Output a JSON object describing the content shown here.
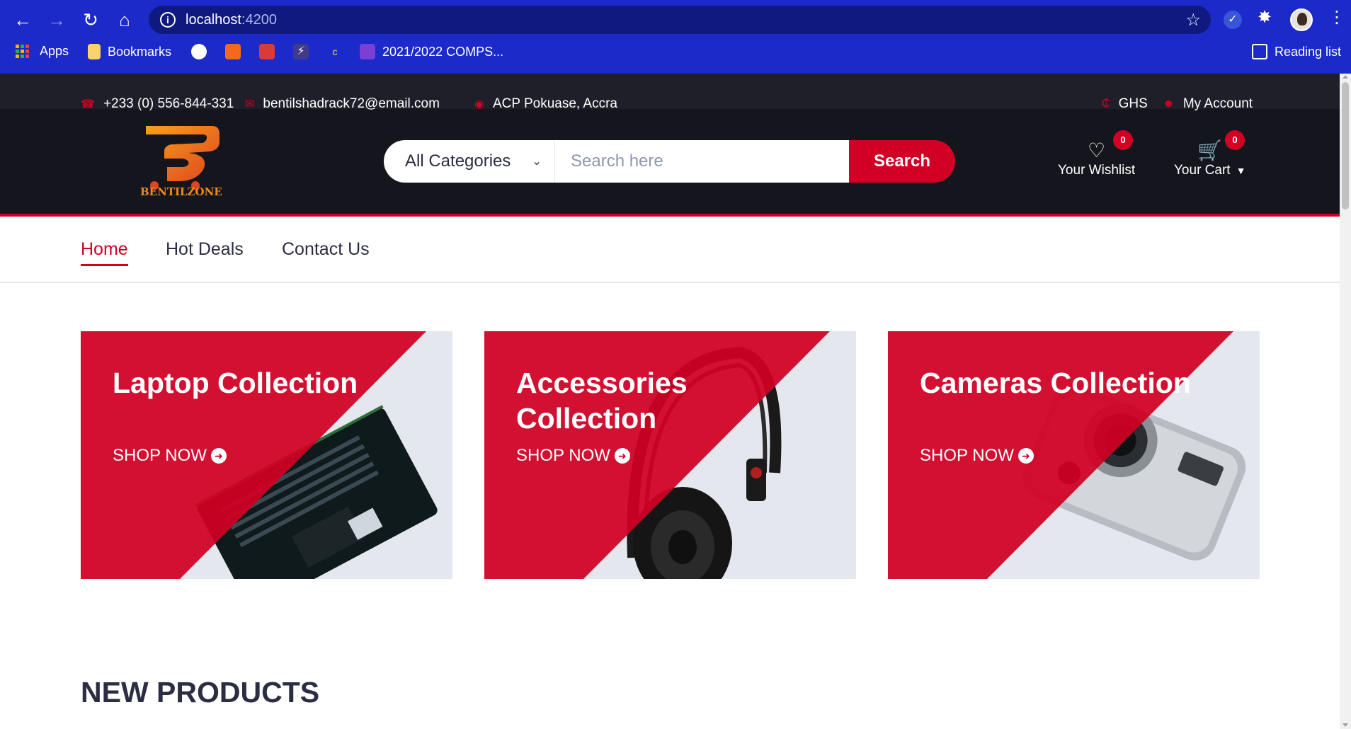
{
  "browser": {
    "url_host": "localhost",
    "url_port": ":4200",
    "bookmarks": [
      {
        "label": "Apps",
        "icon": "apps-grid-icon"
      },
      {
        "label": "Bookmarks",
        "icon": "folder-icon"
      },
      {
        "label": "",
        "icon": "github-icon"
      },
      {
        "label": "",
        "icon": "grid-bookmark-icon"
      },
      {
        "label": "",
        "icon": "spiral-bookmark-icon"
      },
      {
        "label": "",
        "icon": "bolt-bookmark-icon"
      },
      {
        "label": "",
        "icon": "c-bookmark-icon"
      },
      {
        "label": "2021/2022 COMPS...",
        "icon": "list-bookmark-icon"
      }
    ],
    "reading_list": "Reading list"
  },
  "header": {
    "phone": "+233 (0) 556-844-331",
    "email": "bentilshadrack72@email.com",
    "location": "ACP Pokuase, Accra",
    "currency": "GHS",
    "account": "My Account"
  },
  "brand": {
    "name": "BENTILZONE",
    "colors": {
      "accent": "#d10024",
      "dark": "#15161d",
      "logo_orange": "#f28b1a"
    }
  },
  "search": {
    "category": "All Categories",
    "placeholder": "Search here",
    "button": "Search"
  },
  "actions": {
    "wishlist_label": "Your Wishlist",
    "wishlist_count": "0",
    "cart_label": "Your Cart",
    "cart_count": "0"
  },
  "nav": {
    "items": [
      {
        "label": "Home",
        "active": true
      },
      {
        "label": "Hot Deals",
        "active": false
      },
      {
        "label": "Contact Us",
        "active": false
      }
    ]
  },
  "collections": [
    {
      "title": "Laptop Collection",
      "cta": "SHOP NOW",
      "image": "laptop"
    },
    {
      "title": "Accessories Collection",
      "cta": "SHOP NOW",
      "image": "headphones"
    },
    {
      "title": "Cameras Collection",
      "cta": "SHOP NOW",
      "image": "camera"
    }
  ],
  "section": {
    "new_products": "NEW PRODUCTS"
  }
}
